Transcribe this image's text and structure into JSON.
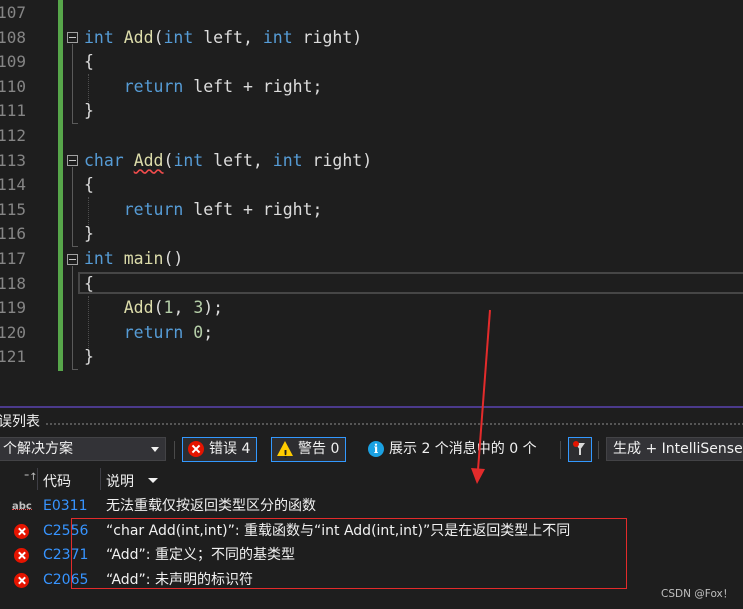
{
  "editor": {
    "line_numbers": [
      "107",
      "108",
      "109",
      "110",
      "111",
      "112",
      "113",
      "114",
      "115",
      "116",
      "117",
      "118",
      "119",
      "120",
      "121"
    ],
    "lines": [
      {
        "num": "107",
        "tokens": []
      },
      {
        "num": "108",
        "tokens": [
          {
            "t": "int",
            "c": "kw"
          },
          {
            "t": " ",
            "c": "plain"
          },
          {
            "t": "Add",
            "c": "fn"
          },
          {
            "t": "(",
            "c": "plain"
          },
          {
            "t": "int",
            "c": "kw"
          },
          {
            "t": " left, ",
            "c": "plain"
          },
          {
            "t": "int",
            "c": "kw"
          },
          {
            "t": " right)",
            "c": "plain"
          }
        ]
      },
      {
        "num": "109",
        "tokens": [
          {
            "t": "{",
            "c": "plain"
          }
        ]
      },
      {
        "num": "110",
        "tokens": [
          {
            "t": "    ",
            "c": "plain"
          },
          {
            "t": "return",
            "c": "kw"
          },
          {
            "t": " left + right;",
            "c": "plain"
          }
        ]
      },
      {
        "num": "111",
        "tokens": [
          {
            "t": "}",
            "c": "plain"
          }
        ]
      },
      {
        "num": "112",
        "tokens": []
      },
      {
        "num": "113",
        "tokens": [
          {
            "t": "char",
            "c": "kw"
          },
          {
            "t": " ",
            "c": "plain"
          },
          {
            "t": "Add",
            "c": "fn squiggle"
          },
          {
            "t": "(",
            "c": "plain"
          },
          {
            "t": "int",
            "c": "kw"
          },
          {
            "t": " left, ",
            "c": "plain"
          },
          {
            "t": "int",
            "c": "kw"
          },
          {
            "t": " right)",
            "c": "plain"
          }
        ]
      },
      {
        "num": "114",
        "tokens": [
          {
            "t": "{",
            "c": "plain"
          }
        ]
      },
      {
        "num": "115",
        "tokens": [
          {
            "t": "    ",
            "c": "plain"
          },
          {
            "t": "return",
            "c": "kw"
          },
          {
            "t": " left + right;",
            "c": "plain"
          }
        ]
      },
      {
        "num": "116",
        "tokens": [
          {
            "t": "}",
            "c": "plain"
          }
        ]
      },
      {
        "num": "117",
        "tokens": [
          {
            "t": "int",
            "c": "kw"
          },
          {
            "t": " ",
            "c": "plain"
          },
          {
            "t": "main",
            "c": "fn"
          },
          {
            "t": "()",
            "c": "plain"
          }
        ]
      },
      {
        "num": "118",
        "tokens": [
          {
            "t": "{",
            "c": "plain"
          }
        ]
      },
      {
        "num": "119",
        "tokens": [
          {
            "t": "    ",
            "c": "plain"
          },
          {
            "t": "Add",
            "c": "fn"
          },
          {
            "t": "(",
            "c": "plain"
          },
          {
            "t": "1",
            "c": "num"
          },
          {
            "t": ", ",
            "c": "plain"
          },
          {
            "t": "3",
            "c": "num"
          },
          {
            "t": ");",
            "c": "plain"
          }
        ]
      },
      {
        "num": "120",
        "tokens": [
          {
            "t": "    ",
            "c": "plain"
          },
          {
            "t": "return",
            "c": "kw"
          },
          {
            "t": " ",
            "c": "plain"
          },
          {
            "t": "0",
            "c": "num"
          },
          {
            "t": ";",
            "c": "plain"
          }
        ]
      },
      {
        "num": "121",
        "tokens": [
          {
            "t": "}",
            "c": "plain"
          }
        ]
      }
    ]
  },
  "error_list": {
    "title": "误列表",
    "scope": "个解决方案",
    "errors_button": "错误 4",
    "warnings_button": "警告 0",
    "messages_text": "展示 2 个消息中的 0 个",
    "build_source": "生成 + IntelliSense",
    "columns": {
      "code": "代码",
      "description": "说明"
    },
    "rows": [
      {
        "severity": "intellisense",
        "code": "E0311",
        "description": "无法重载仅按返回类型区分的函数"
      },
      {
        "severity": "error",
        "code": "C2556",
        "description": "“char Add(int,int)”: 重载函数与“int Add(int,int)”只是在返回类型上不同"
      },
      {
        "severity": "error",
        "code": "C2371",
        "description": "“Add”: 重定义；不同的基类型"
      },
      {
        "severity": "error",
        "code": "C2065",
        "description": "“Add”: 未声明的标识符"
      }
    ]
  },
  "colors": {
    "accent": "#3399ff",
    "error": "#e51400",
    "keyword": "#569cd6",
    "function": "#dcdcaa",
    "annotation": "#e32b2b"
  },
  "watermark": "CSDN @Fox！"
}
